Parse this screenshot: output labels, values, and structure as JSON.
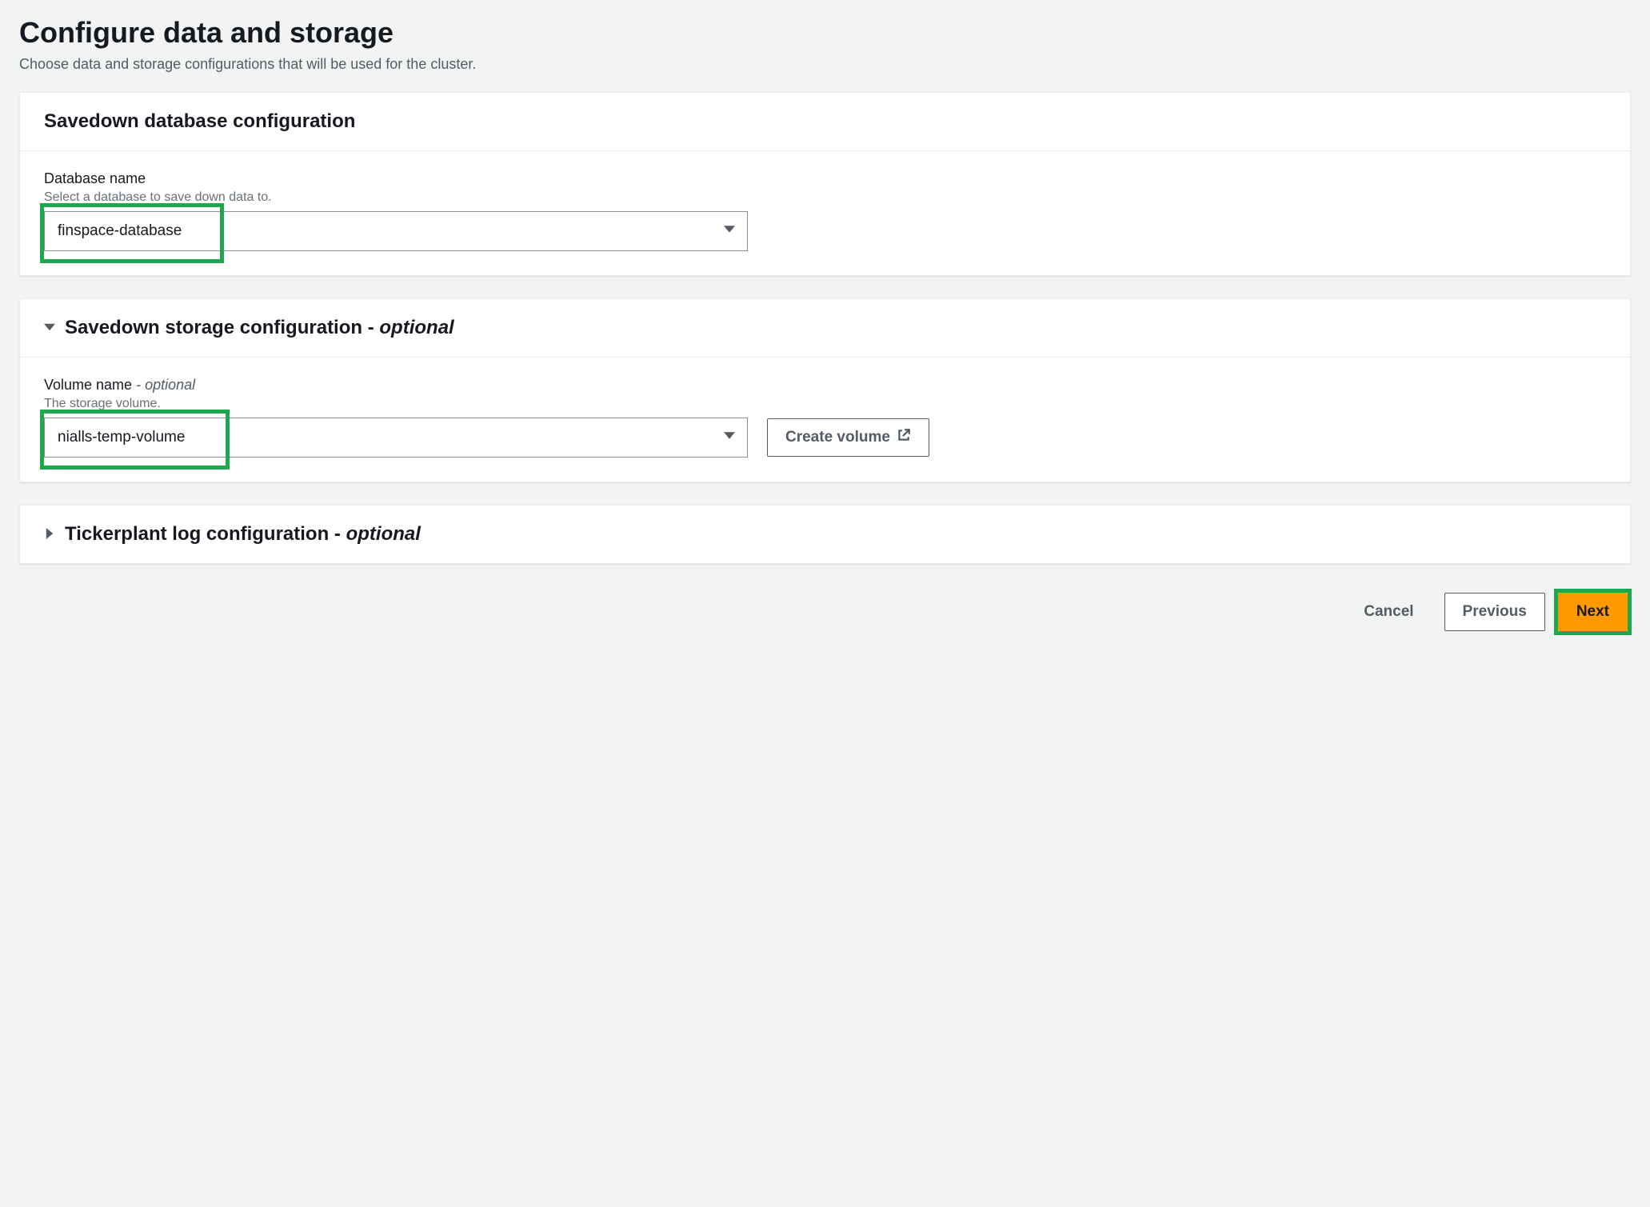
{
  "header": {
    "title": "Configure data and storage",
    "subtitle": "Choose data and storage configurations that will be used for the cluster."
  },
  "savedown_db": {
    "panel_title": "Savedown database configuration",
    "field_label": "Database name",
    "field_hint": "Select a database to save down data to.",
    "selected_value": "finspace-database"
  },
  "savedown_storage": {
    "panel_title_prefix": "Savedown storage configuration ",
    "panel_title_dash": "- ",
    "panel_title_optional": "optional",
    "field_label_prefix": "Volume name ",
    "field_label_dash": "- ",
    "field_label_optional": "optional",
    "field_hint": "The storage volume.",
    "selected_value": "nialls-temp-volume",
    "create_volume_label": "Create volume"
  },
  "tickerplant": {
    "panel_title_prefix": "Tickerplant log configuration ",
    "panel_title_dash": "- ",
    "panel_title_optional": "optional"
  },
  "footer": {
    "cancel": "Cancel",
    "previous": "Previous",
    "next": "Next"
  }
}
